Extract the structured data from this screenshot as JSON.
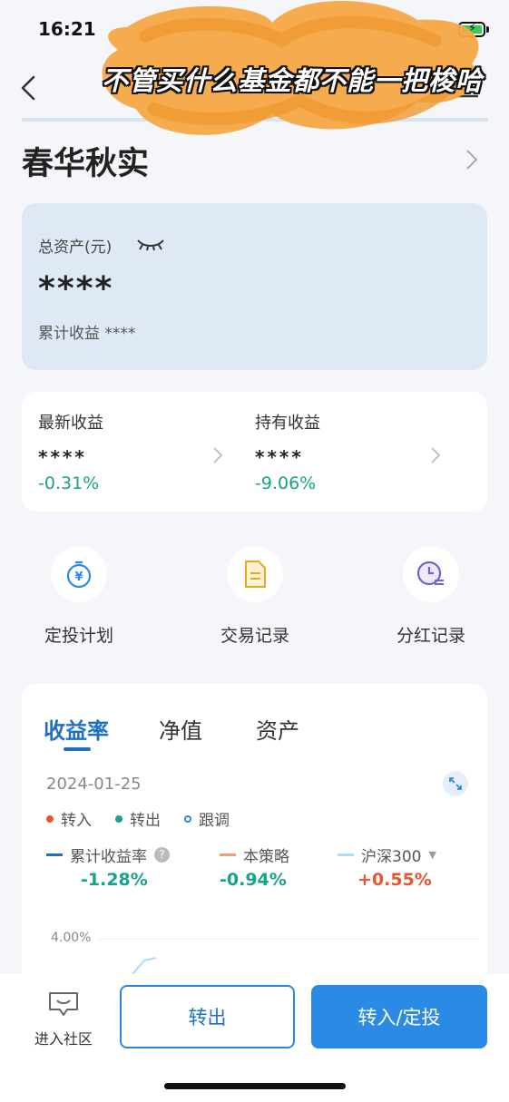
{
  "status": {
    "time": "16:21"
  },
  "overlay": {
    "caption": "不管买什么基金都不能一把梭哈"
  },
  "fund": {
    "name": "春华秋实"
  },
  "assets": {
    "label": "总资产(元)",
    "value": "****",
    "cumulative": "累计收益 ****"
  },
  "income": {
    "latest": {
      "label": "最新收益",
      "value": "****",
      "pct": "-0.31%"
    },
    "holding": {
      "label": "持有收益",
      "value": "****",
      "pct": "-9.06%"
    }
  },
  "actions": [
    {
      "label": "定投计划",
      "icon": "timer-yen-icon"
    },
    {
      "label": "交易记录",
      "icon": "document-icon"
    },
    {
      "label": "分红记录",
      "icon": "clock-list-icon"
    }
  ],
  "chart": {
    "tabs": [
      "收益率",
      "净值",
      "资产"
    ],
    "date": "2024-01-25",
    "markers": [
      {
        "label": "转入",
        "color": "#e8562f"
      },
      {
        "label": "转出",
        "color": "#17a28b"
      },
      {
        "label": "跟调",
        "color": "#2d86e0"
      }
    ],
    "series": [
      {
        "name": "累计收益率",
        "value": "-1.28%",
        "color": "#1f6fc7",
        "value_color": "#17a28b"
      },
      {
        "name": "本策略",
        "value": "-0.94%",
        "color": "#f29a7a",
        "value_color": "#17a28b"
      },
      {
        "name": "沪深300",
        "value": "+0.55%",
        "color": "#a8dcf5",
        "value_color": "#e8562f"
      }
    ],
    "y_tick": "4.00%"
  },
  "bottom": {
    "community_label": "进入社区",
    "out_label": "转出",
    "in_label": "转入/定投"
  },
  "colors": {
    "accent": "#2a8ae6",
    "up": "#e8562f",
    "down": "#17a28b"
  }
}
